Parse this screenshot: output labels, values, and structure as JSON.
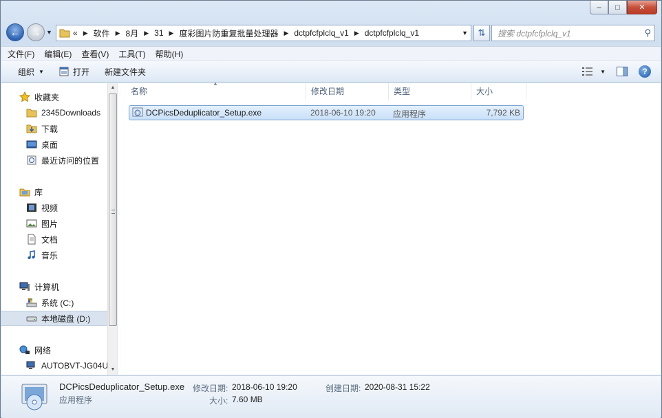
{
  "window": {
    "minimize": "–",
    "maximize": "□",
    "close": "✕"
  },
  "address": {
    "overflow": "«",
    "crumbs": [
      "软件",
      "8月",
      "31",
      "度彩图片防重复批量处理器",
      "dctpfcfplclq_v1",
      "dctpfcfplclq_v1"
    ]
  },
  "search": {
    "placeholder": "搜索 dctpfcfplclq_v1"
  },
  "menu": [
    "文件(F)",
    "编辑(E)",
    "查看(V)",
    "工具(T)",
    "帮助(H)"
  ],
  "toolbar": {
    "organize": "组织",
    "open": "打开",
    "new_folder": "新建文件夹"
  },
  "nav": {
    "favorites": "收藏夹",
    "downloads_2345": "2345Downloads",
    "downloads": "下载",
    "desktop": "桌面",
    "recent": "最近访问的位置",
    "libraries": "库",
    "videos": "视频",
    "pictures": "图片",
    "documents": "文档",
    "music": "音乐",
    "computer": "计算机",
    "drive_c": "系统 (C:)",
    "drive_d": "本地磁盘 (D:)",
    "network": "网络",
    "network_host": "AUTOBVT-JG04U"
  },
  "columns": {
    "name": "名称",
    "modified": "修改日期",
    "type": "类型",
    "size": "大小"
  },
  "files": [
    {
      "name": "DCPicsDeduplicator_Setup.exe",
      "modified": "2018-06-10 19:20",
      "type": "应用程序",
      "size": "7,792 KB"
    }
  ],
  "details": {
    "name": "DCPicsDeduplicator_Setup.exe",
    "type": "应用程序",
    "modified_label": "修改日期:",
    "modified": "2018-06-10 19:20",
    "created_label": "创建日期:",
    "created": "2020-08-31 15:22",
    "size_label": "大小:",
    "size": "7.60 MB"
  },
  "colors": {
    "accent": "#2d62b3",
    "selection": "#c9e0f8",
    "close": "#c7503b"
  }
}
